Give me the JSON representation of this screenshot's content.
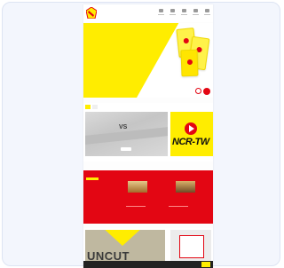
{
  "hero": {
    "colors": {
      "yellow": "#ffed00",
      "red": "#e30613"
    }
  },
  "video": {
    "vs_label": "VS",
    "title": "NCR-TW"
  },
  "bottom": {
    "left_image_text": "UNCUT"
  }
}
